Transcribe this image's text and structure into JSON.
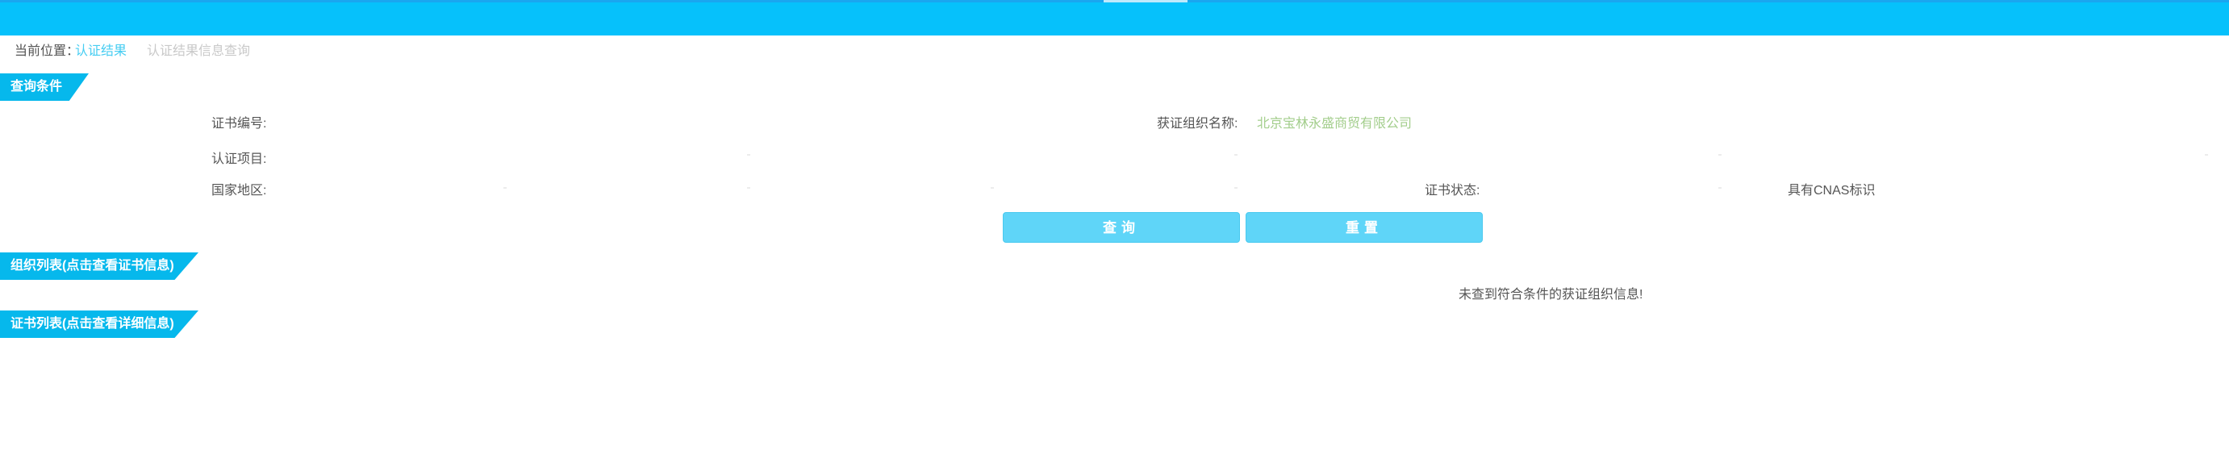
{
  "breadcrumb": {
    "label": "当前位置：",
    "link1": "认证结果",
    "link2": "认证结果信息查询"
  },
  "sections": {
    "query": "查询条件",
    "orgs": "组织列表(点击查看证书信息)",
    "certs": "证书列表(点击查看详细信息)"
  },
  "form": {
    "cert_no_label": "证书编号:",
    "org_name_label": "获证组织名称:",
    "org_name_value": "北京宝林永盛商贸有限公司",
    "project_label": "认证项目:",
    "region_label": "国家地区:",
    "status_label": "证书状态:",
    "cnas_label": "具有CNAS标识"
  },
  "buttons": {
    "query": "查询",
    "reset": "重置"
  },
  "message": {
    "empty": "未查到符合条件的获证组织信息!"
  },
  "colors": {
    "header": "#06c1fb",
    "tab": "#06b8ec",
    "button": "#5fd5f8"
  }
}
